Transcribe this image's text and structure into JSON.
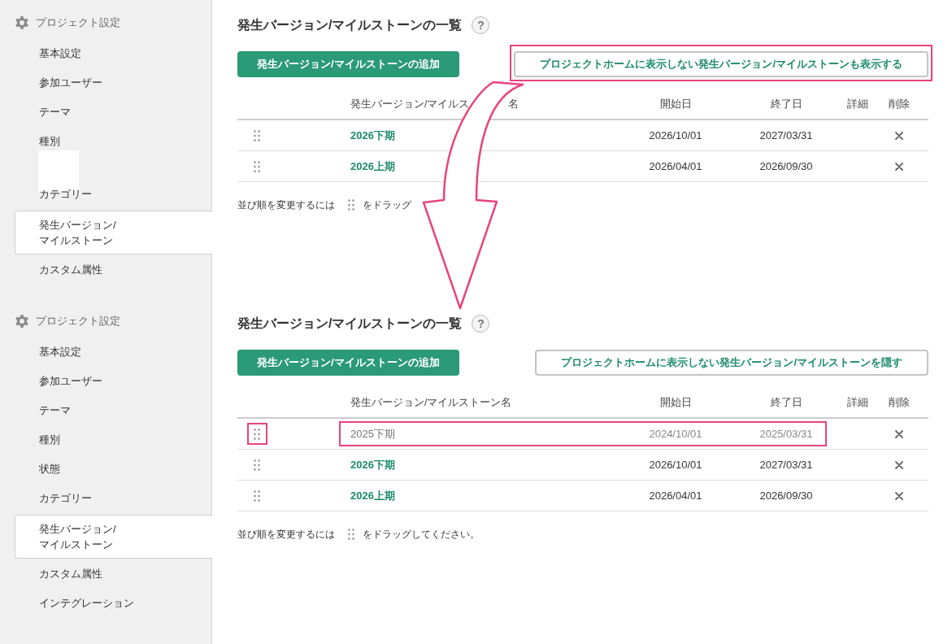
{
  "panels": [
    {
      "sidebar": {
        "header": "プロジェクト設定",
        "items": [
          {
            "kind": "link",
            "label": "基本設定",
            "selected": false
          },
          {
            "kind": "link",
            "label": "参加ユーザー",
            "selected": false
          },
          {
            "kind": "link",
            "label": "テーマ",
            "selected": false
          },
          {
            "kind": "link",
            "label": "種別",
            "selected": false
          },
          {
            "kind": "blank"
          },
          {
            "kind": "link",
            "label": "カテゴリー",
            "selected": false
          },
          {
            "kind": "link",
            "label": "発生バージョン/\nマイルストーン",
            "selected": true
          },
          {
            "kind": "link",
            "label": "カスタム属性",
            "selected": false
          }
        ]
      },
      "main": {
        "title": "発生バージョン/マイルストーンの一覧",
        "help": "?",
        "add_button": "発生バージョン/マイルストーンの追加",
        "toggle_button": {
          "label": "プロジェクトホームに表示しない発生バージョン/マイルストーンも表示する",
          "highlighted": true
        },
        "table": {
          "columns": [
            {
              "label": "発生バージョン/マイルス",
              "tail": "名"
            },
            {
              "label": "開始日"
            },
            {
              "label": "終了日"
            },
            {
              "label": "詳細"
            },
            {
              "label": "削除"
            }
          ],
          "rows": [
            {
              "name": "2026下期",
              "start": "2026/10/01",
              "end": "2027/03/31",
              "hidden": false,
              "highlighted": false
            },
            {
              "name": "2026上期",
              "start": "2026/04/01",
              "end": "2026/09/30",
              "hidden": false,
              "highlighted": false
            }
          ]
        },
        "sort_hint": {
          "lead": "並び順を変更するには",
          "trail": "をドラッグ"
        }
      }
    },
    {
      "sidebar": {
        "header": "プロジェクト設定",
        "items": [
          {
            "kind": "link",
            "label": "基本設定",
            "selected": false
          },
          {
            "kind": "link",
            "label": "参加ユーザー",
            "selected": false
          },
          {
            "kind": "link",
            "label": "テーマ",
            "selected": false
          },
          {
            "kind": "link",
            "label": "種別",
            "selected": false
          },
          {
            "kind": "link",
            "label": "状態",
            "selected": false
          },
          {
            "kind": "link",
            "label": "カテゴリー",
            "selected": false
          },
          {
            "kind": "link",
            "label": "発生バージョン/\nマイルストーン",
            "selected": true
          },
          {
            "kind": "link",
            "label": "カスタム属性",
            "selected": false
          },
          {
            "kind": "link",
            "label": "インテグレーション",
            "selected": false
          }
        ]
      },
      "main": {
        "title": "発生バージョン/マイルストーンの一覧",
        "help": "?",
        "add_button": "発生バージョン/マイルストーンの追加",
        "toggle_button": {
          "label": "プロジェクトホームに表示しない発生バージョン/マイルストーンを隠す",
          "highlighted": false
        },
        "table": {
          "columns": [
            {
              "label": "発生バージョン/マイルストーン名"
            },
            {
              "label": "開始日"
            },
            {
              "label": "終了日"
            },
            {
              "label": "詳細"
            },
            {
              "label": "削除"
            }
          ],
          "rows": [
            {
              "name": "2025下期",
              "start": "2024/10/01",
              "end": "2025/03/31",
              "hidden": true,
              "highlighted": true
            },
            {
              "name": "2026下期",
              "start": "2026/10/01",
              "end": "2027/03/31",
              "hidden": false,
              "highlighted": false
            },
            {
              "name": "2026上期",
              "start": "2026/04/01",
              "end": "2026/09/30",
              "hidden": false,
              "highlighted": false
            }
          ]
        },
        "sort_hint": {
          "lead": "並び順を変更するには",
          "trail": "をドラッグしてください。"
        }
      }
    }
  ]
}
